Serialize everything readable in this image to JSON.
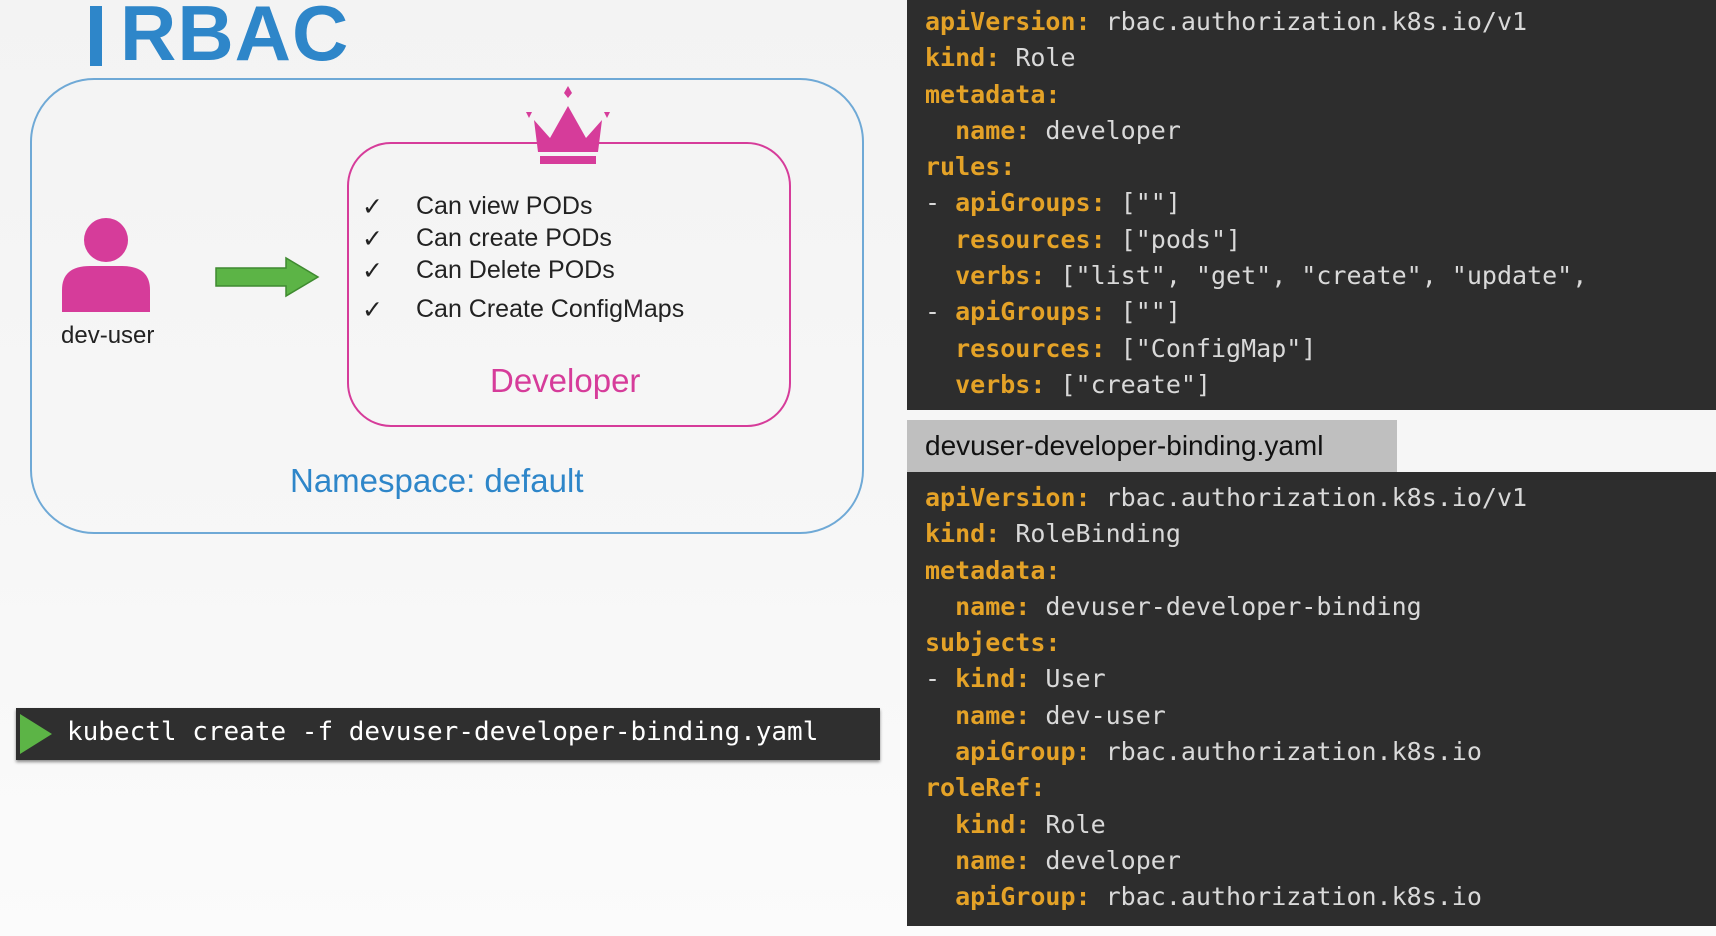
{
  "title": "RBAC",
  "diagram": {
    "namespace_label": "Namespace: default",
    "user_label": "dev-user",
    "role_name": "Developer",
    "check_glyph": "✓",
    "permissions": [
      "Can view PODs",
      "Can create PODs",
      "Can Delete PODs",
      "Can Create ConfigMaps"
    ],
    "icons": {
      "user": "user-icon",
      "arrow": "arrow-right-icon",
      "crown": "crown-icon"
    },
    "colors": {
      "namespace": "#2e86c9",
      "role": "#d63c9a",
      "arrow": "#5cb446",
      "crown": "#d63c9a"
    }
  },
  "command": {
    "icon": "play-icon",
    "text": "kubectl create -f devuser-developer-binding.yaml"
  },
  "role_yaml": {
    "lines": [
      [
        {
          "t": "apiVersion:",
          "c": "k"
        },
        {
          "t": " rbac.authorization.k8s.io/v1",
          "c": "d"
        }
      ],
      [
        {
          "t": "kind:",
          "c": "k"
        },
        {
          "t": " Role",
          "c": "d"
        }
      ],
      [
        {
          "t": "metadata:",
          "c": "k"
        }
      ],
      [
        {
          "t": "  name:",
          "c": "k"
        },
        {
          "t": " developer",
          "c": "d"
        }
      ],
      [
        {
          "t": "rules:",
          "c": "k"
        }
      ],
      [
        {
          "t": "- ",
          "c": "d"
        },
        {
          "t": "apiGroups:",
          "c": "k"
        },
        {
          "t": " [\"\"]",
          "c": "d"
        }
      ],
      [
        {
          "t": "  resources:",
          "c": "k"
        },
        {
          "t": " [\"pods\"]",
          "c": "d"
        }
      ],
      [
        {
          "t": "  verbs:",
          "c": "k"
        },
        {
          "t": " [\"list\", \"get\", \"create\", \"update\",",
          "c": "d"
        }
      ],
      [
        {
          "t": "- ",
          "c": "d"
        },
        {
          "t": "apiGroups:",
          "c": "k"
        },
        {
          "t": " [\"\"]",
          "c": "d"
        }
      ],
      [
        {
          "t": "  resources:",
          "c": "k"
        },
        {
          "t": " [\"ConfigMap\"]",
          "c": "d"
        }
      ],
      [
        {
          "t": "  verbs:",
          "c": "k"
        },
        {
          "t": " [\"create\"]",
          "c": "d"
        }
      ]
    ]
  },
  "binding_file": {
    "tab_label": "devuser-developer-binding.yaml",
    "lines": [
      [
        {
          "t": "apiVersion:",
          "c": "k"
        },
        {
          "t": " rbac.authorization.k8s.io/v1",
          "c": "d"
        }
      ],
      [
        {
          "t": "kind:",
          "c": "k"
        },
        {
          "t": " RoleBinding",
          "c": "d"
        }
      ],
      [
        {
          "t": "metadata:",
          "c": "k"
        }
      ],
      [
        {
          "t": "  name:",
          "c": "k"
        },
        {
          "t": " devuser-developer-binding",
          "c": "d"
        }
      ],
      [
        {
          "t": "subjects:",
          "c": "k"
        }
      ],
      [
        {
          "t": "- ",
          "c": "d"
        },
        {
          "t": "kind:",
          "c": "k"
        },
        {
          "t": " User",
          "c": "d"
        }
      ],
      [
        {
          "t": "  name:",
          "c": "k"
        },
        {
          "t": " dev-user",
          "c": "d"
        }
      ],
      [
        {
          "t": "  apiGroup:",
          "c": "k"
        },
        {
          "t": " rbac.authorization.k8s.io",
          "c": "d"
        }
      ],
      [
        {
          "t": "roleRef:",
          "c": "k"
        }
      ],
      [
        {
          "t": "  kind:",
          "c": "k"
        },
        {
          "t": " Role",
          "c": "d"
        }
      ],
      [
        {
          "t": "  name:",
          "c": "k"
        },
        {
          "t": " developer",
          "c": "d"
        }
      ],
      [
        {
          "t": "  apiGroup:",
          "c": "k"
        },
        {
          "t": " rbac.authorization.k8s.io",
          "c": "d"
        }
      ]
    ]
  }
}
